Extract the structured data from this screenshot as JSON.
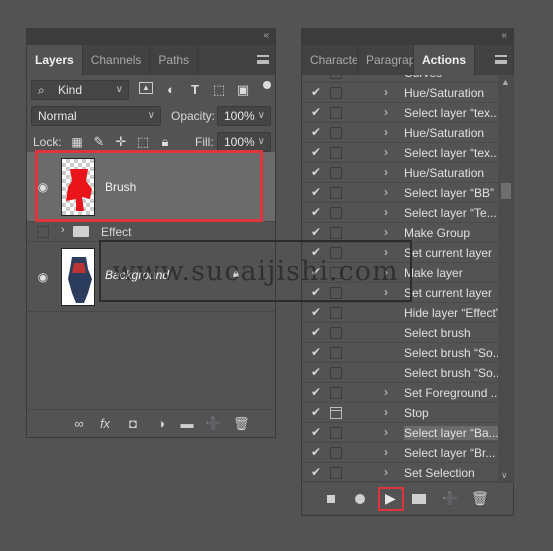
{
  "layers_panel": {
    "tabs": [
      {
        "label": "Layers",
        "active": true
      },
      {
        "label": "Channels",
        "active": false
      },
      {
        "label": "Paths",
        "active": false
      }
    ],
    "filter": {
      "value": "Kind"
    },
    "blend_mode": {
      "value": "Normal"
    },
    "opacity": {
      "label": "Opacity:",
      "value": "100%"
    },
    "lock": {
      "label": "Lock:"
    },
    "fill": {
      "label": "Fill:",
      "value": "100%"
    },
    "layers": [
      {
        "name": "Brush",
        "visible": true,
        "selected": true
      },
      {
        "name": "Effect",
        "visible": false,
        "is_group": true
      },
      {
        "name": "Background",
        "visible": true,
        "locked": true
      }
    ]
  },
  "actions_panel": {
    "tabs": [
      {
        "label": "Character",
        "active": false
      },
      {
        "label": "Paragraph",
        "active": false
      },
      {
        "label": "Actions",
        "active": true
      }
    ],
    "items": [
      {
        "label": "Curves",
        "expandable": true,
        "dialog": false
      },
      {
        "label": "Hue/Saturation",
        "expandable": true,
        "dialog": false
      },
      {
        "label": "Select layer “tex...",
        "expandable": true,
        "dialog": false
      },
      {
        "label": "Hue/Saturation",
        "expandable": true,
        "dialog": false
      },
      {
        "label": "Select layer “tex...",
        "expandable": true,
        "dialog": false
      },
      {
        "label": "Hue/Saturation",
        "expandable": true,
        "dialog": false
      },
      {
        "label": "Select layer “BB”",
        "expandable": true,
        "dialog": false
      },
      {
        "label": "Select layer “Te...",
        "expandable": true,
        "dialog": false
      },
      {
        "label": "Make Group",
        "expandable": true,
        "dialog": false
      },
      {
        "label": "Set current layer",
        "expandable": true,
        "dialog": false
      },
      {
        "label": "Make layer",
        "expandable": true,
        "dialog": false
      },
      {
        "label": "Set current layer",
        "expandable": true,
        "dialog": false
      },
      {
        "label": "Hide layer “Effect”",
        "expandable": false,
        "dialog": false
      },
      {
        "label": "Select brush",
        "expandable": false,
        "dialog": false
      },
      {
        "label": "Select brush “So...",
        "expandable": false,
        "dialog": false
      },
      {
        "label": "Select brush “So...",
        "expandable": false,
        "dialog": false
      },
      {
        "label": "Set Foreground ...",
        "expandable": true,
        "dialog": false
      },
      {
        "label": "Stop",
        "expandable": true,
        "dialog": true
      },
      {
        "label": "Select layer “Ba...",
        "expandable": true,
        "dialog": false,
        "selected": true
      },
      {
        "label": "Select layer “Br...",
        "expandable": true,
        "dialog": false
      },
      {
        "label": "Set Selection",
        "expandable": true,
        "dialog": false
      }
    ]
  },
  "watermark": {
    "text": "www.sucaijishi.com"
  },
  "colors": {
    "highlight": "#e0343c",
    "panel": "#535353",
    "tabbar": "#424242"
  }
}
